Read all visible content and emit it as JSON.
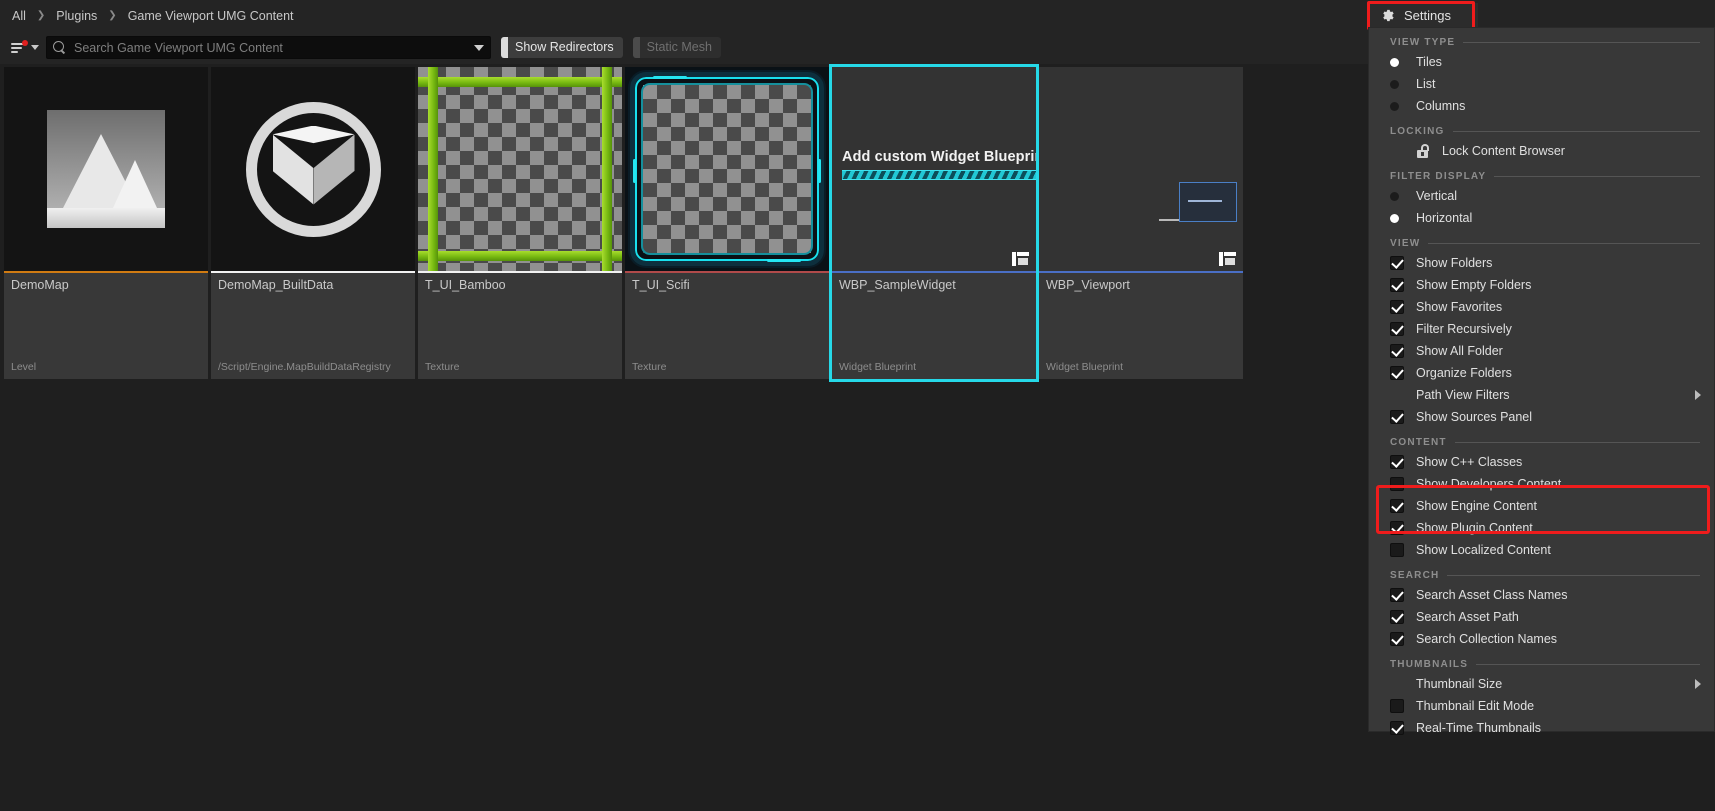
{
  "breadcrumb": {
    "items": [
      "All",
      "Plugins",
      "Game Viewport UMG Content"
    ],
    "separator": "❯"
  },
  "search": {
    "placeholder": "Search Game Viewport UMG Content",
    "value": "",
    "filter_icon": "filter-icon",
    "magnifier_icon": "search-icon"
  },
  "filters": [
    {
      "label": "Show Redirectors",
      "active": true
    },
    {
      "label": "Static Mesh",
      "active": false
    }
  ],
  "assets": [
    {
      "name": "DemoMap",
      "class": "Level",
      "accent": "#d07b12",
      "thumb": "map-icon",
      "selected": false
    },
    {
      "name": "DemoMap_BuiltData",
      "class": "/Script/Engine.MapBuildDataRegistry",
      "accent": "#f2f2f2",
      "thumb": "cube-ring-icon",
      "selected": false
    },
    {
      "name": "T_UI_Bamboo",
      "class": "Texture",
      "accent": "#f2f2f2",
      "thumb": "bamboo-texture",
      "selected": false
    },
    {
      "name": "T_UI_Scifi",
      "class": "Texture",
      "accent": "#b04a4a",
      "thumb": "scifi-texture",
      "selected": false
    },
    {
      "name": "WBP_SampleWidget",
      "class": "Widget Blueprint",
      "accent": "#4a6fc6",
      "thumb": "sample-widget-preview",
      "banner": "Add custom Widget Blueprints",
      "selected": true
    },
    {
      "name": "WBP_Viewport",
      "class": "Widget Blueprint",
      "accent": "#4a6fc6",
      "thumb": "viewport-widget-preview",
      "selected": false
    }
  ],
  "settings": {
    "title": "Settings",
    "gear_icon": "gear-icon",
    "highlight_color": "#ef1c1c",
    "sections": {
      "view_type": {
        "header": "VIEW TYPE",
        "options": [
          {
            "label": "Tiles",
            "selected": true
          },
          {
            "label": "List",
            "selected": false
          },
          {
            "label": "Columns",
            "selected": false
          }
        ]
      },
      "locking": {
        "header": "LOCKING",
        "items": [
          {
            "label": "Lock Content Browser",
            "icon": "unlocked-padlock-icon"
          }
        ]
      },
      "filter_display": {
        "header": "FILTER DISPLAY",
        "options": [
          {
            "label": "Vertical",
            "selected": false
          },
          {
            "label": "Horizontal",
            "selected": true
          }
        ]
      },
      "view": {
        "header": "VIEW",
        "items": [
          {
            "label": "Show Folders",
            "checked": true,
            "type": "check"
          },
          {
            "label": "Show Empty Folders",
            "checked": true,
            "type": "check"
          },
          {
            "label": "Show Favorites",
            "checked": true,
            "type": "check"
          },
          {
            "label": "Filter Recursively",
            "checked": true,
            "type": "check"
          },
          {
            "label": "Show All Folder",
            "checked": true,
            "type": "check"
          },
          {
            "label": "Organize Folders",
            "checked": true,
            "type": "check"
          },
          {
            "label": "Path View Filters",
            "type": "submenu"
          },
          {
            "label": "Show Sources Panel",
            "checked": true,
            "type": "check"
          }
        ]
      },
      "content": {
        "header": "CONTENT",
        "items": [
          {
            "label": "Show C++ Classes",
            "checked": true,
            "type": "check"
          },
          {
            "label": "Show Developers Content",
            "checked": false,
            "type": "check"
          },
          {
            "label": "Show Engine Content",
            "checked": true,
            "type": "check",
            "highlighted": true
          },
          {
            "label": "Show Plugin Content",
            "checked": true,
            "type": "check",
            "highlighted": true
          },
          {
            "label": "Show Localized Content",
            "checked": false,
            "type": "check"
          }
        ]
      },
      "search": {
        "header": "SEARCH",
        "items": [
          {
            "label": "Search Asset Class Names",
            "checked": true,
            "type": "check"
          },
          {
            "label": "Search Asset Path",
            "checked": true,
            "type": "check"
          },
          {
            "label": "Search Collection Names",
            "checked": true,
            "type": "check"
          }
        ]
      },
      "thumbnails": {
        "header": "THUMBNAILS",
        "items": [
          {
            "label": "Thumbnail Size",
            "type": "submenu"
          },
          {
            "label": "Thumbnail Edit Mode",
            "checked": false,
            "type": "check"
          },
          {
            "label": "Real-Time Thumbnails",
            "checked": true,
            "type": "check"
          }
        ]
      }
    }
  }
}
